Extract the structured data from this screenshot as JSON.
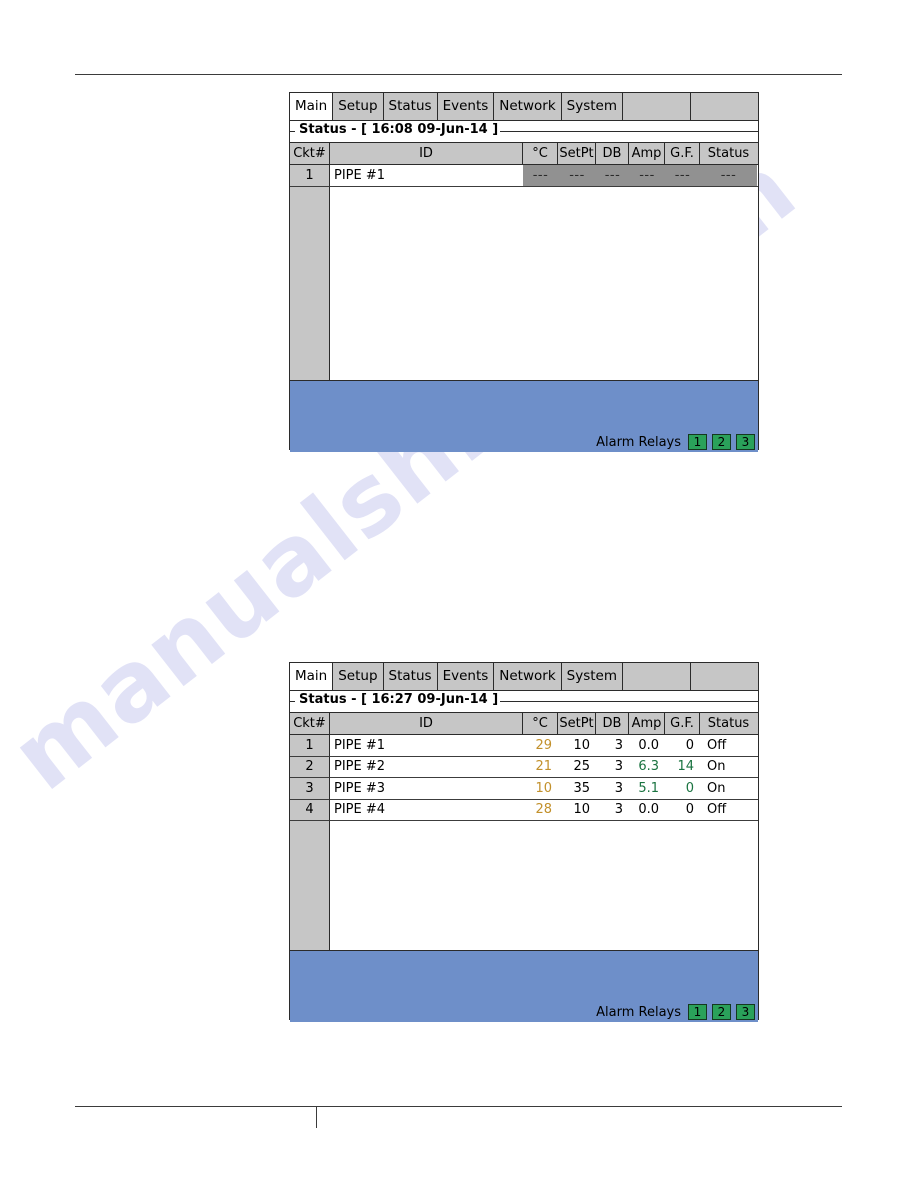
{
  "watermark": {
    "text": "manualshive.com"
  },
  "screens": [
    {
      "name": "status-screen-1608",
      "tabs": [
        {
          "label": "Main",
          "active": true
        },
        {
          "label": "Setup",
          "active": false
        },
        {
          "label": "Status",
          "active": false
        },
        {
          "label": "Events",
          "active": false
        },
        {
          "label": "Network",
          "active": false
        },
        {
          "label": "System",
          "active": false
        }
      ],
      "group_title": "Status - [ 16:08  09-Jun-14 ]",
      "columns": [
        "Ckt#",
        "ID",
        "°C",
        "SetPt",
        "DB",
        "Amp",
        "G.F.",
        "Status"
      ],
      "rows": [
        {
          "ckt": "1",
          "id": "PIPE #1",
          "temp": "---",
          "setpt": "---",
          "db": "---",
          "amp": "---",
          "gf": "---",
          "status": "---",
          "nodata": true
        },
        {
          "ckt": "",
          "blank": true
        },
        {
          "ckt": "",
          "blank": true
        },
        {
          "ckt": "",
          "blank": true
        },
        {
          "ckt": "",
          "blank": true
        },
        {
          "ckt": "",
          "blank": true
        },
        {
          "ckt": "",
          "blank": true
        },
        {
          "ckt": "",
          "blank": true
        },
        {
          "ckt": "",
          "blank": true
        },
        {
          "ckt": "",
          "blank": true
        }
      ],
      "footer": {
        "alarm_relays_label": "Alarm Relays",
        "relays": [
          {
            "label": "1",
            "state": "green"
          },
          {
            "label": "2",
            "state": "green"
          },
          {
            "label": "3",
            "state": "green"
          }
        ]
      }
    },
    {
      "name": "status-screen-1627",
      "tabs": [
        {
          "label": "Main",
          "active": true
        },
        {
          "label": "Setup",
          "active": false
        },
        {
          "label": "Status",
          "active": false
        },
        {
          "label": "Events",
          "active": false
        },
        {
          "label": "Network",
          "active": false
        },
        {
          "label": "System",
          "active": false
        }
      ],
      "group_title": "Status - [ 16:27  09-Jun-14 ]",
      "columns": [
        "Ckt#",
        "ID",
        "°C",
        "SetPt",
        "DB",
        "Amp",
        "G.F.",
        "Status"
      ],
      "rows": [
        {
          "ckt": "1",
          "id": "PIPE #1",
          "temp": "29",
          "setpt": "10",
          "db": "3",
          "amp": "0.0",
          "gf": "0",
          "status": "Off",
          "amp_color": "black",
          "gf_color": "black"
        },
        {
          "ckt": "2",
          "id": "PIPE #2",
          "temp": "21",
          "setpt": "25",
          "db": "3",
          "amp": "6.3",
          "gf": "14",
          "status": "On",
          "amp_color": "green",
          "gf_color": "green"
        },
        {
          "ckt": "3",
          "id": "PIPE #3",
          "temp": "10",
          "setpt": "35",
          "db": "3",
          "amp": "5.1",
          "gf": "0",
          "status": "On",
          "amp_color": "green",
          "gf_color": "green"
        },
        {
          "ckt": "4",
          "id": "PIPE #4",
          "temp": "28",
          "setpt": "10",
          "db": "3",
          "amp": "0.0",
          "gf": "0",
          "status": "Off",
          "amp_color": "black",
          "gf_color": "black"
        },
        {
          "ckt": "",
          "blank": true
        },
        {
          "ckt": "",
          "blank": true
        },
        {
          "ckt": "",
          "blank": true
        },
        {
          "ckt": "",
          "blank": true
        },
        {
          "ckt": "",
          "blank": true
        },
        {
          "ckt": "",
          "blank": true
        }
      ],
      "footer": {
        "alarm_relays_label": "Alarm Relays",
        "relays": [
          {
            "label": "1",
            "state": "green"
          },
          {
            "label": "2",
            "state": "green"
          },
          {
            "label": "3",
            "state": "green"
          }
        ]
      }
    }
  ],
  "colors": {
    "temp_value": "#c2902b",
    "active_value": "#1a7340",
    "footer_blue": "#6e8fc9",
    "relay_green": "#2aa15a",
    "header_gray": "#c6c6c6",
    "nodata_gray": "#919191"
  }
}
